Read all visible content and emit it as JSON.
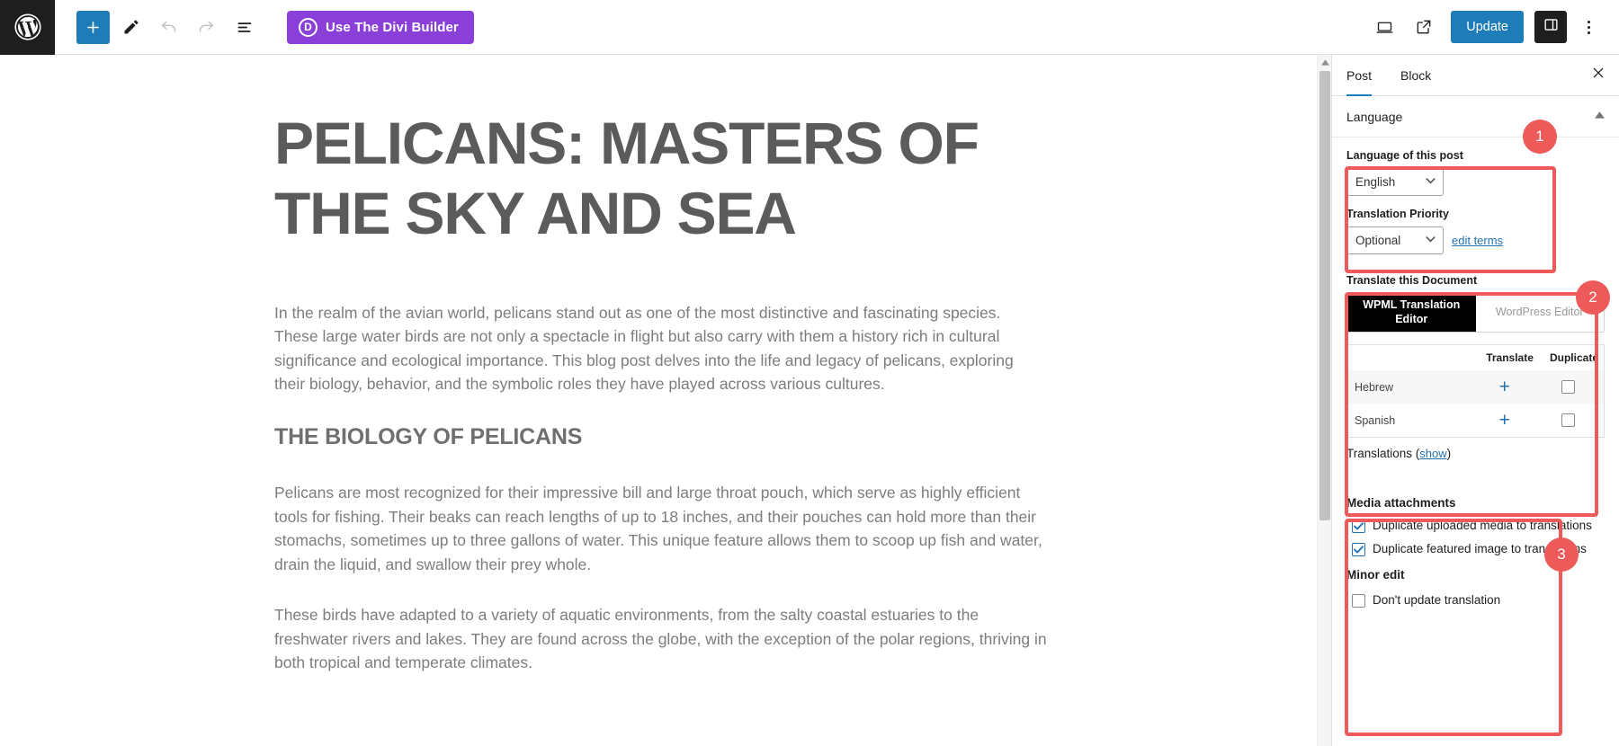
{
  "toolbar": {
    "wordpress_logo_icon": "wordpress-logo",
    "add_block_label": "+",
    "edit_tool_icon": "pencil-icon",
    "undo_icon": "undo-arrow-icon",
    "redo_icon": "redo-arrow-icon",
    "list_view_icon": "document-outline-icon",
    "divi_button_label": "Use The Divi Builder",
    "divi_badge_letter": "D",
    "divi_button_color": "#8b3fd9",
    "view_icon": "desktop-preview-icon",
    "external_link_icon": "view-post-external-icon",
    "update_label": "Update",
    "update_button_color": "#1e7cb8",
    "settings_panel_icon": "settings-sidebar-icon",
    "options_icon": "kebab-menu-icon"
  },
  "document": {
    "title": "PELICANS: MASTERS OF THE SKY AND SEA",
    "paragraph_1": "In the realm of the avian world, pelicans stand out as one of the most distinctive and fascinating species. These large water birds are not only a spectacle in flight but also carry with them a history rich in cultural significance and ecological importance. This blog post delves into the life and legacy of pelicans, exploring their biology, behavior, and the symbolic roles they have played across various cultures.",
    "heading_2": "THE BIOLOGY OF PELICANS",
    "paragraph_2": "Pelicans are most recognized for their impressive bill and large throat pouch, which serve as highly efficient tools for fishing. Their beaks can reach lengths of up to 18 inches, and their pouches can hold more than their stomachs, sometimes up to three gallons of water. This unique feature allows them to scoop up fish and water, drain the liquid, and swallow their prey whole.",
    "paragraph_3": "These birds have adapted to a variety of aquatic environments, from the salty coastal estuaries to the freshwater rivers and lakes. They are found across the globe, with the exception of the polar regions, thriving in both tropical and temperate climates."
  },
  "sidebar": {
    "tabs": [
      {
        "label": "Post",
        "active": true
      },
      {
        "label": "Block",
        "active": false
      }
    ],
    "close_icon": "close-x-icon",
    "panel": {
      "title": "Language",
      "collapse_icon": "chevron-up-icon"
    },
    "language_section": {
      "language_label": "Language of this post",
      "language_value": "English",
      "priority_label": "Translation Priority",
      "priority_value": "Optional",
      "edit_terms_link": "edit terms"
    },
    "translate_section": {
      "title": "Translate this Document",
      "editor_options": [
        {
          "label": "WPML Translation Editor",
          "selected": true
        },
        {
          "label": "WordPress Editor",
          "selected": false
        }
      ],
      "table": {
        "headers": [
          "",
          "Translate",
          "Duplicate"
        ],
        "rows": [
          {
            "language": "Hebrew",
            "translate_icon": "plus-icon",
            "duplicate_checked": false
          },
          {
            "language": "Spanish",
            "translate_icon": "plus-icon",
            "duplicate_checked": false
          }
        ]
      },
      "translations_label": "Translations",
      "translations_show_link": "show"
    },
    "media_section": {
      "title": "Media attachments",
      "checkboxes": [
        {
          "label": "Duplicate uploaded media to translations",
          "checked": true
        },
        {
          "label": "Duplicate featured image to translations",
          "checked": true
        }
      ],
      "minor_edit_label": "Minor edit",
      "minor_edit_checkbox": {
        "label": "Don't update translation",
        "checked": false
      }
    }
  },
  "annotations": {
    "color": "#ee5a5a",
    "badges": [
      {
        "number": "1"
      },
      {
        "number": "2"
      },
      {
        "number": "3"
      }
    ]
  },
  "scrollbar": {
    "up_arrow_icon": "scroll-up-arrow-icon"
  }
}
